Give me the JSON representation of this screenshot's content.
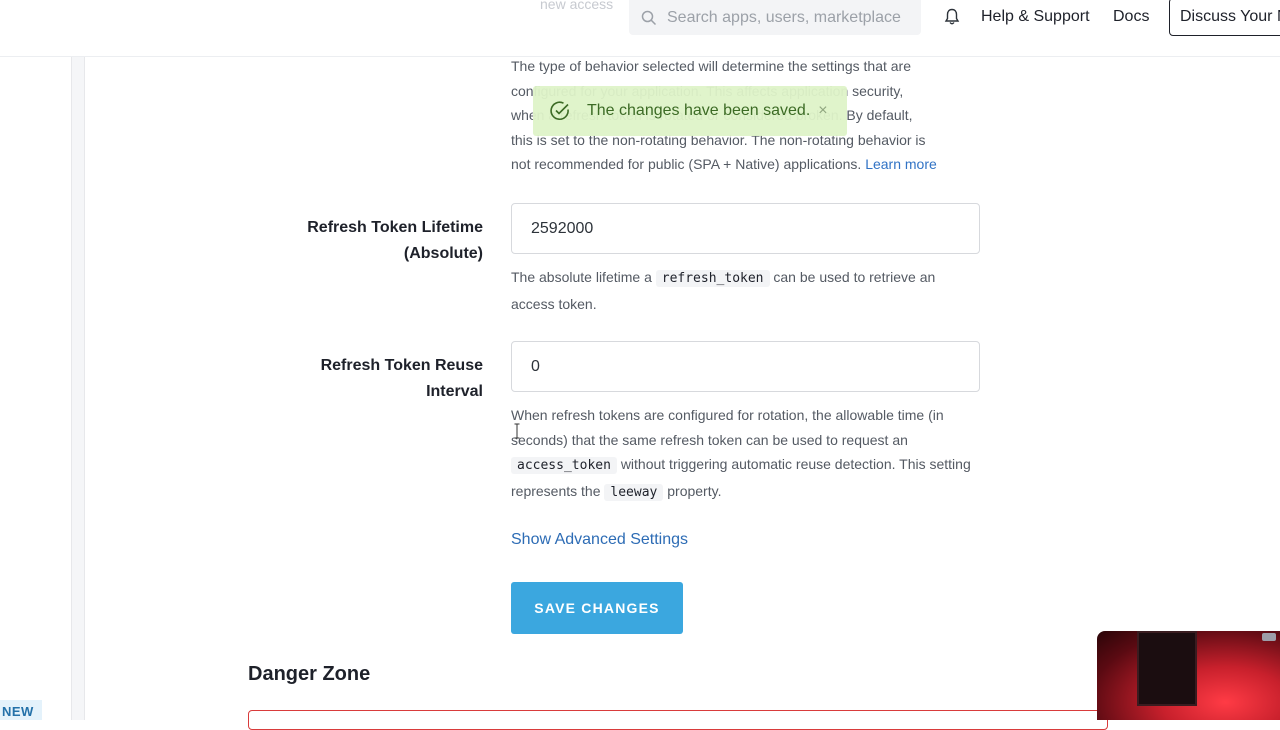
{
  "header": {
    "ghost_text": "new access",
    "search_placeholder": "Search apps, users, marketplace",
    "help_label": "Help & Support",
    "docs_label": "Docs",
    "discuss_label": "Discuss Your Needs"
  },
  "sidebar": {
    "new_badge": "NEW"
  },
  "rotation": {
    "desc_line1": "The type of behavior selected will determine the settings that are",
    "desc_line2": "configured for your application. This affects application security,",
    "desc_line3": "when a refresh token is rotated or considered broken. By default,",
    "desc_line4": "this is set to the non-rotating behavior. The non-rotating behavior is",
    "desc_line5": "not recommended for public (SPA + Native) applications.",
    "learn_more": "Learn more"
  },
  "toast": {
    "message": "The changes have been saved.",
    "close": "×"
  },
  "lifetime": {
    "label_line1": "Refresh Token Lifetime",
    "label_line2": "(Absolute)",
    "value": "2592000",
    "desc_pre": "The absolute lifetime a",
    "desc_code": "refresh_token",
    "desc_post": "can be used to retrieve an access token."
  },
  "reuse": {
    "label": "Refresh Token Reuse Interval",
    "value": "0",
    "desc_1": "When refresh tokens are configured for rotation, the allowable time (in seconds) that the same refresh token can be used to request an",
    "desc_code1": "access_token",
    "desc_2": "without triggering automatic reuse detection. This setting represents the",
    "desc_code2": "leeway",
    "desc_3": "property."
  },
  "actions": {
    "advanced_link": "Show Advanced Settings",
    "save_label": "SAVE CHANGES"
  },
  "danger": {
    "title": "Danger Zone"
  },
  "colors": {
    "accent": "#3ba7df",
    "link": "#3173c5",
    "toast_bg": "#def3c8",
    "danger": "#d93b3b"
  }
}
